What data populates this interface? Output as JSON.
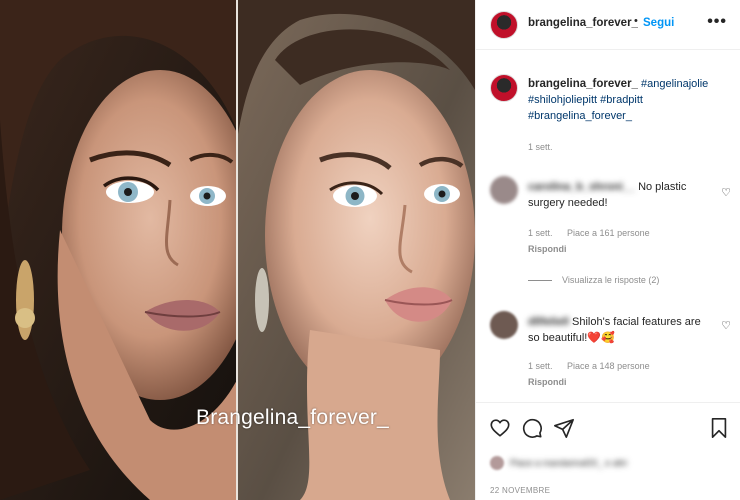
{
  "photo": {
    "watermark": "Brangelina_forever_"
  },
  "header": {
    "username": "brangelina_forever_",
    "separator": "•",
    "follow_label": "Segui",
    "more_icon": "more-horizontal-icon"
  },
  "caption": {
    "username": "brangelina_forever_",
    "hashtags": [
      "#angelinajolie",
      "#shilohjoliepitt",
      "#bradpitt",
      "#brangelina_forever_"
    ],
    "time": "1 sett."
  },
  "comments": [
    {
      "user": "carolina_b_shroni__",
      "text": "No plastic surgery needed!",
      "time": "1 sett.",
      "likes": "Piace a 161 persone",
      "reply_label": "Rispondi"
    },
    {
      "user": "dllfeliell",
      "text": "Shiloh's facial features are so beautiful!",
      "emoji": "❤️🥰",
      "time": "1 sett.",
      "likes": "Piace a 148 persone",
      "reply_label": "Rispondi"
    }
  ],
  "view_replies": "Visualizza le risposte (2)",
  "actions": {
    "like_icon": "heart-icon",
    "comment_icon": "comment-icon",
    "share_icon": "paper-plane-icon",
    "save_icon": "bookmark-icon"
  },
  "likes_summary": "Piace a mandarinaf20_ e altri",
  "date": "22 NOVEMBRE",
  "colors": {
    "accent": "#0095f6",
    "hashtag": "#00376b",
    "muted": "#8e8e8e",
    "text": "#262626"
  }
}
